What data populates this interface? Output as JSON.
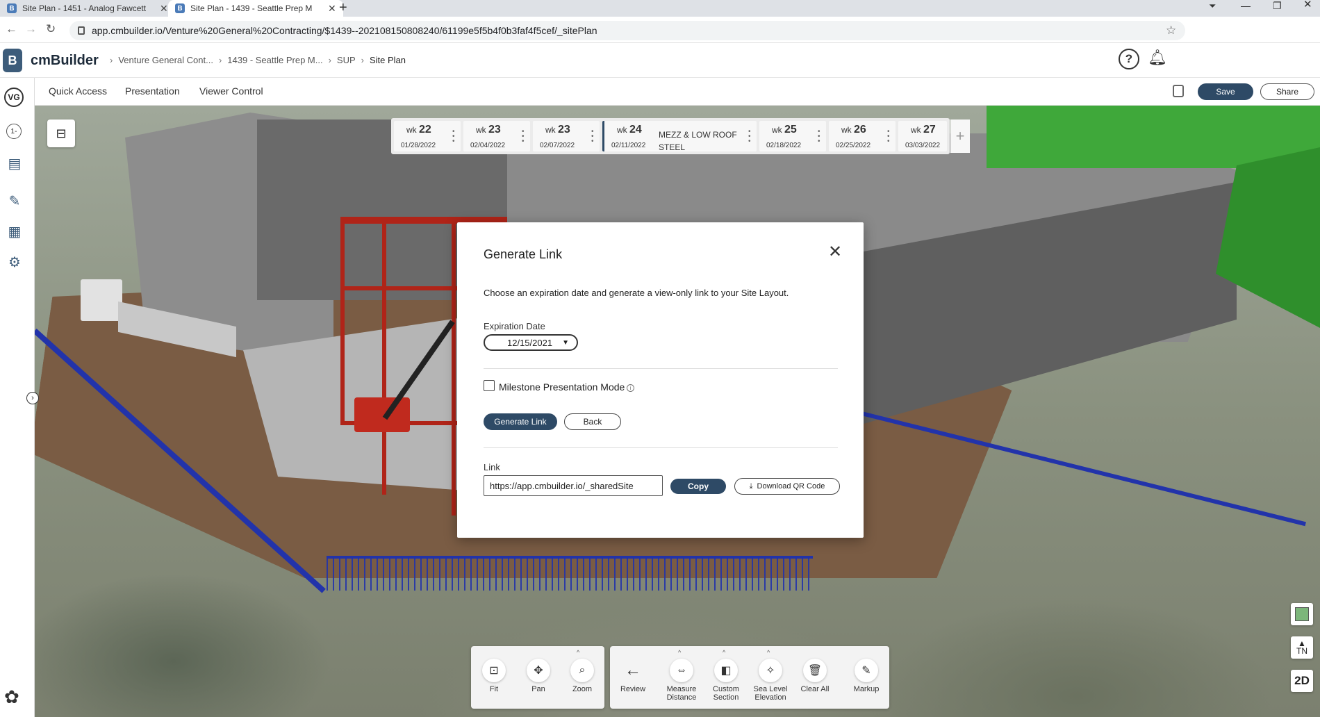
{
  "browser": {
    "tabs": [
      {
        "title": "Site Plan - 1451 - Analog Fawcett",
        "active": false
      },
      {
        "title": "Site Plan - 1439 - Seattle Prep M",
        "active": true
      }
    ],
    "url": "app.cmbuilder.io/Venture%20General%20Contracting/$1439--202108150808240/61199e5f5b4f0b3faf4f5cef/_sitePlan"
  },
  "app": {
    "brand": "cmBuilder",
    "breadcrumbs": [
      "Venture General Cont...",
      "1439 - Seattle Prep M...",
      "SUP",
      "Site Plan"
    ],
    "user_initials": "VG",
    "rail_badge": "1-"
  },
  "toolbar": {
    "menus": [
      "Quick Access",
      "Presentation",
      "Viewer Control"
    ],
    "save_label": "Save",
    "share_label": "Share"
  },
  "timeline": {
    "weeks": [
      {
        "label": "wk",
        "num": "22",
        "date": "01/28/2022"
      },
      {
        "label": "wk",
        "num": "23",
        "date": "02/04/2022"
      },
      {
        "label": "wk",
        "num": "23",
        "date": "02/07/2022"
      },
      {
        "label": "wk",
        "num": "24",
        "date": "02/11/2022",
        "milestone_line1": "MEZZ & LOW ROOF",
        "milestone_line2": "STEEL"
      },
      {
        "label": "wk",
        "num": "25",
        "date": "02/18/2022"
      },
      {
        "label": "wk",
        "num": "26",
        "date": "02/25/2022"
      },
      {
        "label": "wk",
        "num": "27",
        "date": "03/03/2022"
      }
    ]
  },
  "modal": {
    "title": "Generate Link",
    "description": "Choose an expiration date and generate a view-only link to your Site Layout.",
    "expiration_label": "Expiration Date",
    "expiration_value": "12/15/2021",
    "milestone_label": "Milestone Presentation Mode",
    "milestone_checked": false,
    "generate_label": "Generate Link",
    "back_label": "Back",
    "link_label": "Link",
    "link_value": "https://app.cmbuilder.io/_sharedSite",
    "copy_label": "Copy",
    "qr_label": "Download QR Code"
  },
  "bottom_tools": {
    "group1": [
      {
        "label": "Fit",
        "icon": "fit-icon"
      },
      {
        "label": "Pan",
        "icon": "pan-icon"
      },
      {
        "label": "Zoom",
        "icon": "zoom-icon"
      }
    ],
    "group2": [
      {
        "label": "Review",
        "icon": "arrow-left-icon"
      },
      {
        "label": "Measure Distance",
        "line1": "Measure",
        "line2": "Distance",
        "icon": "ruler-icon"
      },
      {
        "label": "Custom Section",
        "line1": "Custom",
        "line2": "Section",
        "icon": "section-icon"
      },
      {
        "label": "Sea Level Elevation",
        "line1": "Sea Level",
        "line2": "Elevation",
        "icon": "elevation-icon"
      },
      {
        "label": "Clear All",
        "icon": "trash-icon"
      },
      {
        "label": "Markup",
        "icon": "pencil-icon"
      }
    ]
  },
  "right_controls": {
    "compass": "TN",
    "view_mode": "2D"
  },
  "colors": {
    "primary": "#2e4a66",
    "building_gray": "#6e6e6e",
    "steel_red": "#b02418",
    "fence_blue": "#2233aa",
    "green_block": "#3fa83a"
  }
}
